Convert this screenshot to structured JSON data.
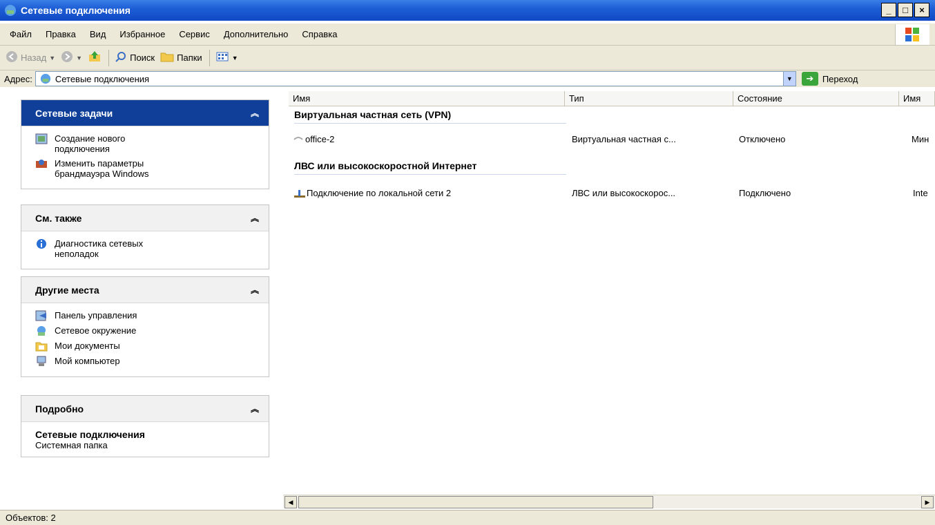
{
  "window": {
    "title": "Сетевые подключения"
  },
  "menu": [
    "Файл",
    "Правка",
    "Вид",
    "Избранное",
    "Сервис",
    "Дополнительно",
    "Справка"
  ],
  "toolbar": {
    "back": "Назад",
    "search": "Поиск",
    "folders": "Папки"
  },
  "address": {
    "label": "Адрес:",
    "value": "Сетевые подключения",
    "go": "Переход"
  },
  "tasks": {
    "title": "Сетевые задачи",
    "items": [
      {
        "label": "Создание нового подключения"
      },
      {
        "label": "Изменить параметры брандмауэра Windows"
      }
    ]
  },
  "see_also": {
    "title": "См. также",
    "items": [
      {
        "label": "Диагностика сетевых неполадок"
      }
    ]
  },
  "other_places": {
    "title": "Другие места",
    "items": [
      {
        "label": "Панель управления"
      },
      {
        "label": "Сетевое окружение"
      },
      {
        "label": "Мои документы"
      },
      {
        "label": "Мой компьютер"
      }
    ]
  },
  "details": {
    "title": "Подробно",
    "name": "Сетевые подключения",
    "desc": "Системная папка"
  },
  "columns": [
    "Имя",
    "Тип",
    "Состояние",
    "Имя"
  ],
  "groups": [
    {
      "title": "Виртуальная частная сеть (VPN)",
      "rows": [
        {
          "name": "office-2",
          "type": "Виртуальная частная с...",
          "status": "Отключено",
          "extra": "Мин"
        }
      ]
    },
    {
      "title": "ЛВС или высокоскоростной Интернет",
      "rows": [
        {
          "name": "Подключение по локальной сети 2",
          "type": "ЛВС или высокоскорос...",
          "status": "Подключено",
          "extra": "Inte"
        }
      ]
    }
  ],
  "status": {
    "text": "Объектов: 2"
  },
  "colors": {
    "titlebar": "#1e5fd6",
    "panelhead": "#0f3f98",
    "chrome": "#ece9d8"
  },
  "icons": [
    "network-connections-icon",
    "back-icon",
    "forward-icon",
    "up-icon",
    "search-icon",
    "folders-icon",
    "views-icon",
    "go-icon"
  ]
}
